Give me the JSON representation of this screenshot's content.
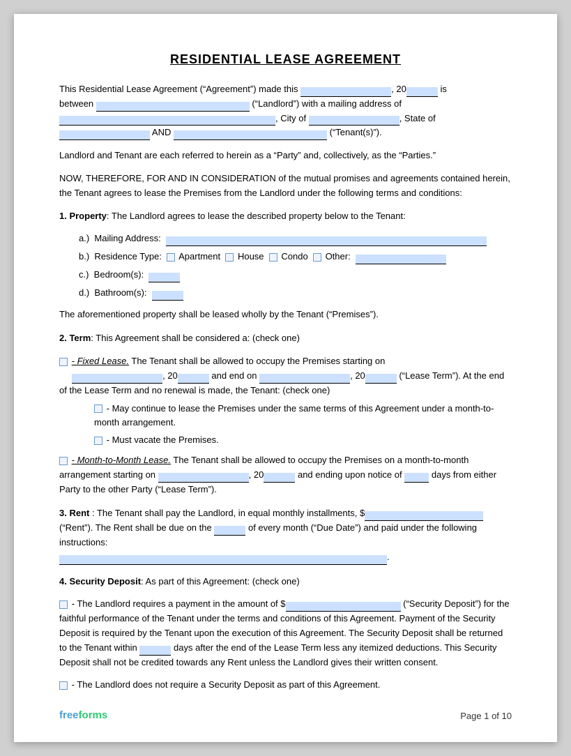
{
  "title": "RESIDENTIAL LEASE AGREEMENT",
  "intro": {
    "line1": "This Residential Lease Agreement (“Agreement”) made this",
    "year_prefix": ", 20",
    "year_suffix": " is",
    "line2_prefix": "between",
    "landlord_suffix": "(“Landlord”) with a mailing address of",
    "city_prefix": ", City of",
    "state_suffix": ", State of",
    "and_label": "AND",
    "tenant_suffix": "(“Tenant(s)”)."
  },
  "party_note": "Landlord and Tenant are each referred to herein as a “Party” and, collectively, as the “Parties.”",
  "consideration": "NOW, THEREFORE, FOR AND IN CONSIDERATION of the mutual promises and agreements contained herein, the Tenant agrees to lease the Premises from the Landlord under the following terms and conditions:",
  "section1": {
    "header": "1. Property",
    "text": ": The Landlord agrees to lease the described property below to the Tenant:",
    "items": [
      {
        "label": "a.)",
        "field": "Mailing Address:"
      },
      {
        "label": "b.)",
        "field": "Residence Type:"
      },
      {
        "label": "c.)",
        "field": "Bedroom(s):"
      },
      {
        "label": "d.)",
        "field": "Bathroom(s):"
      }
    ],
    "residence_types": [
      "Apartment",
      "House",
      "Condo",
      "Other:"
    ],
    "premises_note": "The aforementioned property shall be leased wholly by the Tenant (“Premises”)."
  },
  "section2": {
    "header": "2. Term",
    "text": ": This Agreement shall be considered a: (check one)",
    "fixed_label": "- Fixed Lease.",
    "fixed_text1": "The Tenant shall be allowed to occupy the Premises starting on",
    "fixed_text2": ", 20",
    "fixed_text3": "and end on",
    "fixed_text4": ", 20",
    "fixed_text5": "(“Lease Term”). At the end of the Lease Term and no renewal is made, the Tenant: (check one)",
    "sub1": "- May continue to lease the Premises under the same terms of this Agreement under a month-to-month arrangement.",
    "sub2": "- Must vacate the Premises.",
    "month_label": "- Month-to-Month Lease.",
    "month_text1": "The Tenant shall be allowed to occupy the Premises on a month-to-month arrangement starting on",
    "month_text2": ", 20",
    "month_text3": "and ending upon notice of",
    "month_text4": "days from either Party to the other Party (“Lease Term”)."
  },
  "section3": {
    "header": "3. Rent",
    "text1": ": The Tenant shall pay the Landlord, in equal monthly installments, $",
    "text2": "(“Rent”). The Rent shall be due on the",
    "text3": "of every month (“Due Date”) and paid under the following instructions:",
    "period_end": "."
  },
  "section4": {
    "header": "4. Security Deposit",
    "text": ": As part of this Agreement: (check one)",
    "option1_prefix": "- The Landlord requires a payment in the amount of $",
    "option1_suffix": "(“Security Deposit”) for the faithful performance of the Tenant under the terms and conditions of this Agreement. Payment of the Security Deposit is required by the Tenant upon the execution of this Agreement. The Security Deposit shall be returned to the Tenant within",
    "option1_mid": "days after the end of the Lease Term less any itemized deductions. This Security Deposit shall not be credited towards any Rent unless the Landlord gives their written consent.",
    "option2": "- The Landlord does not require a Security Deposit as part of this Agreement."
  },
  "footer": {
    "logo_free": "free",
    "logo_forms": "forms",
    "page_label": "Page 1 of 10"
  }
}
